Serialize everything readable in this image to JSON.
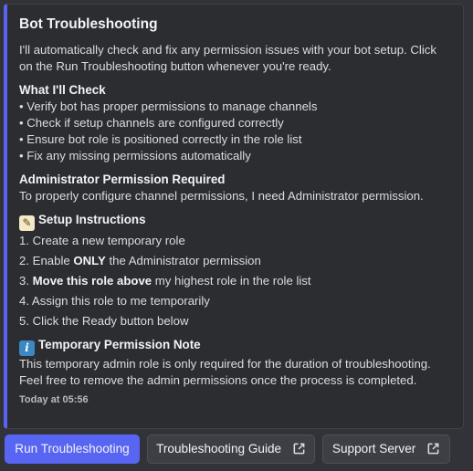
{
  "embed": {
    "title": "Bot Troubleshooting",
    "intro_line1": "I'll automatically check and fix any permission issues with your bot setup. Click",
    "intro_line2": "on the Run Troubleshooting button whenever you're ready.",
    "check_heading": "What I'll Check",
    "checks": [
      "• Verify bot has proper permissions to manage channels",
      "• Check if setup channels are configured correctly",
      "• Ensure bot role is positioned correctly in the role list",
      "• Fix any missing permissions automatically"
    ],
    "admin_heading": "Administrator Permission Required",
    "admin_text": "To properly configure channel permissions, I need Administrator permission.",
    "setup_heading": "Setup Instructions",
    "setup_icon": "memo-icon",
    "steps": {
      "s1": "1. Create a new temporary role",
      "s2_pre": "2. Enable ",
      "s2_bold": "ONLY",
      "s2_post": " the Administrator permission",
      "s3_pre": "3. ",
      "s3_bold": "Move this role above",
      "s3_post": " my highest role in the role list",
      "s4": "4. Assign this role to me temporarily",
      "s5": "5. Click the Ready button below"
    },
    "note_heading": "Temporary Permission Note",
    "note_icon": "info-icon",
    "note_line1": "This temporary admin role is only required for the duration of troubleshooting.",
    "note_line2": "Feel free to remove the admin permissions once the process is completed.",
    "timestamp": "Today at 05:56",
    "accent_color": "#5865f2"
  },
  "buttons": {
    "run": "Run Troubleshooting",
    "guide": "Troubleshooting Guide",
    "support": "Support Server"
  }
}
